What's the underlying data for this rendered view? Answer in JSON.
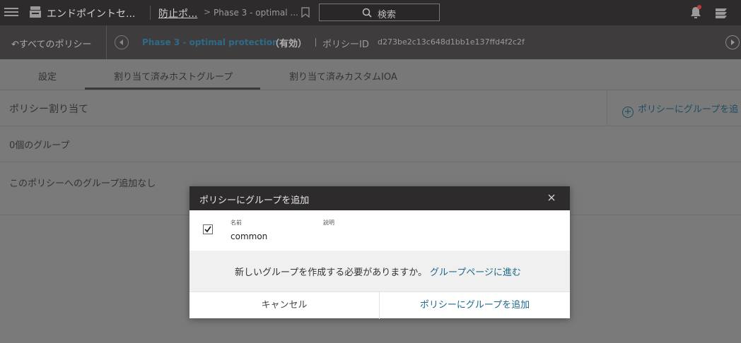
{
  "topbar": {
    "app_title": "エンドポイントセ...",
    "crumb1": "防止ポ...",
    "crumb2": "Phase 3 - optimal ...",
    "search_label": "検索"
  },
  "subbar": {
    "back_label": "すべてのポリシー",
    "policy_name": "Phase 3 - optimal protection",
    "status": "（有効）",
    "policy_id_label": "ポリシーID",
    "policy_id": "d273be2c13c648d1bb1e137ffd4f2c2f"
  },
  "tabs": [
    {
      "label": "設定"
    },
    {
      "label": "割り当て済みホストグループ"
    },
    {
      "label": "割り当て済みカスタムIOA"
    }
  ],
  "content": {
    "section_title": "ポリシー割り当て",
    "add_link": "ポリシーにグループを追",
    "group_count": "0個のグループ",
    "empty_message": "このポリシーへのグループ追加なし"
  },
  "modal": {
    "title": "ポリシーにグループを追加",
    "col_name": "名前",
    "col_desc": "説明",
    "group_name": "common",
    "notice": "新しいグループを作成する必要がありますか。",
    "notice_link": "グループページに進む",
    "cancel_label": "キャンセル",
    "confirm_label": "ポリシーにグループを追加"
  },
  "colors": {
    "topbar_bg": "#2e2b2d",
    "link": "#1d6a8a",
    "alert_dot": "#c23b3b"
  },
  "icons": [
    "menu-icon",
    "app-icon",
    "bookmark-icon",
    "search-icon",
    "bell-icon",
    "stack-icon",
    "back-icon",
    "prev-icon",
    "next-icon",
    "plus-circle-icon",
    "close-icon",
    "check-icon"
  ]
}
